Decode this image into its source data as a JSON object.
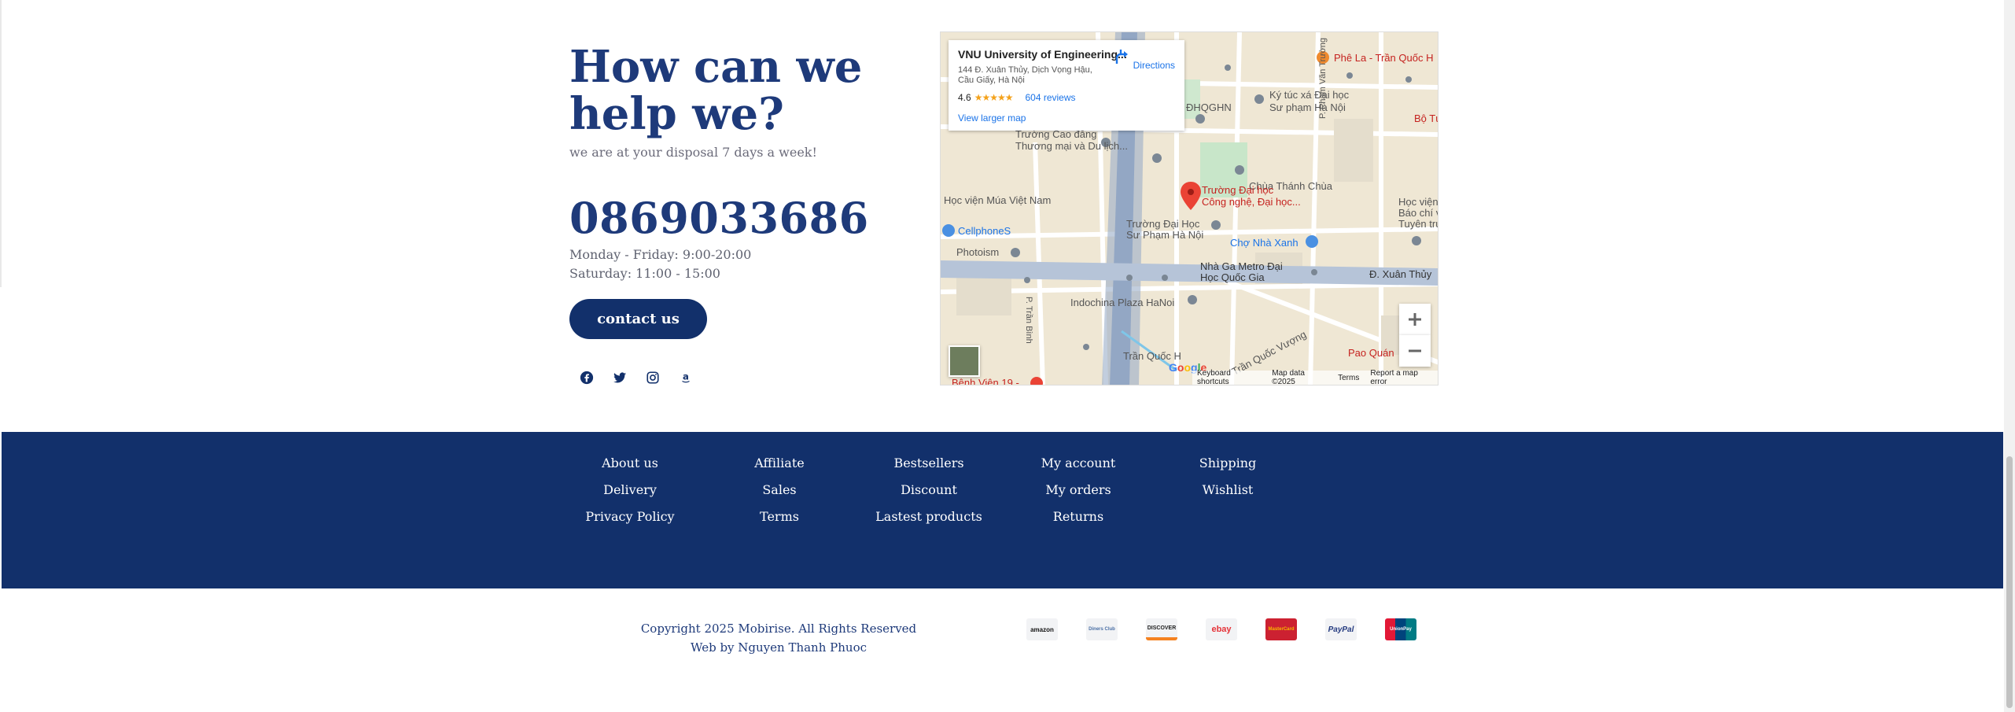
{
  "contact": {
    "heading": "How can we help we?",
    "subtitle": "we are at your disposal 7 days a week!",
    "phone": "0869033686",
    "hours_weekday": "Monday - Friday: 9:00-20:00",
    "hours_saturday": "Saturday: 11:00 - 15:00",
    "button_label": "contact us",
    "socials": [
      "facebook-icon",
      "twitter-icon",
      "instagram-icon",
      "amazon-icon"
    ]
  },
  "map": {
    "place_title": "VNU University of Engineering...",
    "address": "144 Đ. Xuân Thủy, Dịch Vọng Hậu, Cầu Giấy, Hà Nội",
    "rating": "4.6",
    "stars": "★★★★★",
    "reviews": "604 reviews",
    "larger_map": "View larger map",
    "directions": "Directions",
    "labels": {
      "pho_la": "Phê La - Trần Quốc H",
      "ky_tuc_xa": "Ký túc xá Đại học",
      "ky_tuc_xa2": "Sư phạm Hà Nội",
      "chua_thanh": "Chùa Thánh Chùa",
      "truong_dai_hoc": "Trường Đại học",
      "cong_nghe": "Công nghệ, Đại học...",
      "hoc_vien_mua": "Học viện Múa Việt Nam",
      "cellphones": "CellphoneS",
      "photoism": "Photoism",
      "dhsp": "Trường Đại Học",
      "dhsp2": "Sư Phạm Hà Nội",
      "cho_nha_xanh": "Chợ Nhà Xanh",
      "metro": "Nhà Ga Metro Đại",
      "metro2": "Học Quốc Gia",
      "xuan_thuy": "Đ. Xuân Thủy",
      "indochina": "Indochina Plaza HaNoi",
      "tran_quoc": "Trần Quốc H",
      "tran_quoc_vuong": "Trần Quốc Vượng",
      "pao_quan": "Pao Quán",
      "benh_vien": "Bệnh Viện 19 -",
      "cao_dang": "Trường Cao đẳng",
      "cao_dang2": "Thương mại và Du lịch...",
      "dhqghn": "ĐHQGHN",
      "hoc_vien_right": "Học viện",
      "hoc_vien_right2": "Báo chí và",
      "hoc_vien_right3": "Tuyên truy",
      "bo_tu": "Bộ Tư",
      "p_tran_binh": "P. Trần Bình",
      "p_phao_van_truong": "P. Phạm Văn Trường"
    },
    "footer": {
      "shortcuts": "Keyboard shortcuts",
      "map_data": "Map data ©2025",
      "terms": "Terms",
      "report": "Report a map error"
    },
    "google": "Google"
  },
  "footer": {
    "columns": [
      [
        "About us",
        "Delivery",
        "Privacy Policy"
      ],
      [
        "Affiliate",
        "Sales",
        "Terms"
      ],
      [
        "Bestsellers",
        "Discount",
        "Lastest products"
      ],
      [
        "My account",
        "My orders",
        "Returns"
      ],
      [
        "Shipping",
        "Wishlist"
      ]
    ]
  },
  "bottom": {
    "copyright": "Copyright 2025 Mobirise. All Rights Reserved",
    "credit": "Web by Nguyen Thanh Phuoc",
    "payments": [
      "amazon",
      "Diners Club",
      "DISCOVER",
      "ebay",
      "MasterCard",
      "PayPal",
      "UnionPay"
    ]
  },
  "colors": {
    "navy": "#12306b",
    "heading": "#1e3a7a",
    "map_bg": "#efe7d4"
  }
}
